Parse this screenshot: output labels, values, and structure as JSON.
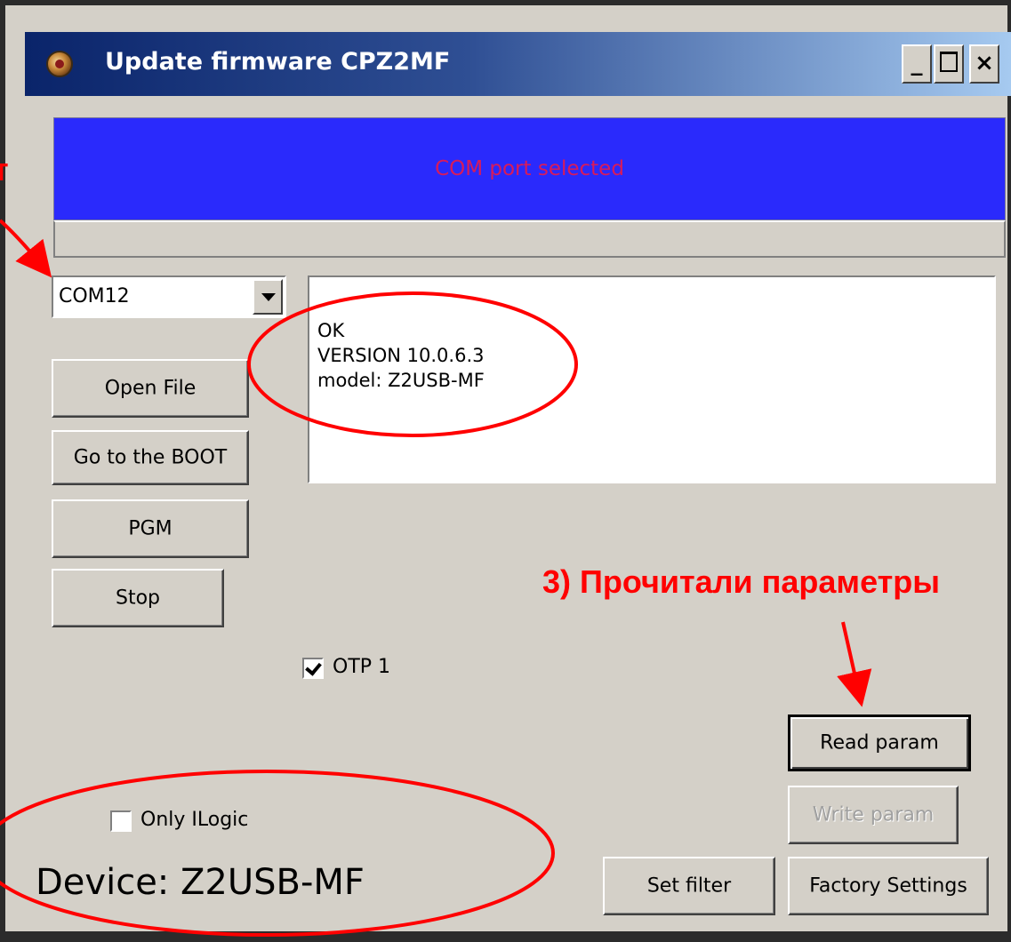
{
  "window": {
    "title": "Update firmware CPZ2MF",
    "minimize_glyph": "_",
    "close_glyph": "×"
  },
  "status": {
    "message": "COM port selected"
  },
  "port": {
    "selected": "COM12"
  },
  "buttons": {
    "open_file": "Open File",
    "go_boot": "Go to the BOOT",
    "pgm": "PGM",
    "stop": "Stop",
    "read_param": "Read param",
    "write_param": "Write param",
    "set_filter": "Set filter",
    "factory_settings": "Factory Settings"
  },
  "log": {
    "lines": [
      "OK",
      "VERSION  10.0.6.3",
      "model: Z2USB-MF"
    ]
  },
  "options": {
    "otp1_label": "OTP 1",
    "otp1_checked": true,
    "only_ilogic_label": "Only ILogic",
    "only_ilogic_checked": false
  },
  "device": {
    "label": "Device: Z2USB-MF"
  },
  "annotations": {
    "step3": "3) Прочитали параметры",
    "left_fragment": "т",
    "color": "#ff0000"
  },
  "colors": {
    "status_bg": "#2a2afc",
    "status_text": "#d81b5a",
    "window_bg": "#d4d0c8"
  }
}
